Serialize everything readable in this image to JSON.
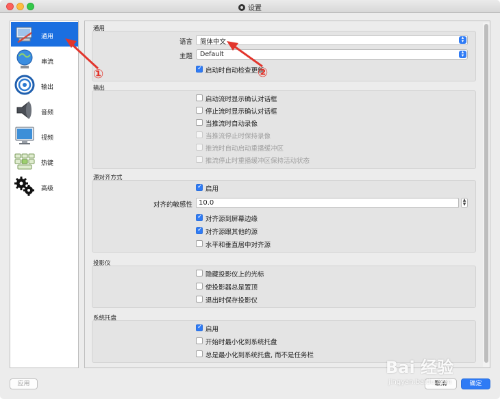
{
  "window": {
    "title": "设置"
  },
  "sidebar": {
    "items": [
      {
        "label": "通用",
        "icon": "general-icon",
        "active": true
      },
      {
        "label": "串流",
        "icon": "stream-icon"
      },
      {
        "label": "输出",
        "icon": "output-icon"
      },
      {
        "label": "音频",
        "icon": "audio-icon"
      },
      {
        "label": "视频",
        "icon": "video-icon"
      },
      {
        "label": "热键",
        "icon": "hotkeys-icon"
      },
      {
        "label": "高级",
        "icon": "advanced-icon"
      }
    ]
  },
  "general": {
    "section_title": "通用",
    "language_label": "语言",
    "language_value": "简体中文",
    "theme_label": "主题",
    "theme_value": "Default",
    "check_updates": {
      "label": "启动时自动检查更新",
      "checked": true
    }
  },
  "output": {
    "section_title": "输出",
    "options": [
      {
        "label": "启动流时显示确认对话框",
        "checked": false,
        "disabled": false
      },
      {
        "label": "停止流时显示确认对话框",
        "checked": false,
        "disabled": false
      },
      {
        "label": "当推流时自动录像",
        "checked": false,
        "disabled": false
      },
      {
        "label": "当推流停止时保持录像",
        "checked": false,
        "disabled": true
      },
      {
        "label": "推流时自动启动重播缓冲区",
        "checked": false,
        "disabled": true
      },
      {
        "label": "推流停止时重播缓冲区保持活动状态",
        "checked": false,
        "disabled": true
      }
    ]
  },
  "snapping": {
    "section_title": "源对齐方式",
    "enable": {
      "label": "启用",
      "checked": true
    },
    "sensitivity_label": "对齐的敏感性",
    "sensitivity_value": "10.0",
    "options": [
      {
        "label": "对齐源到屏幕边缘",
        "checked": true
      },
      {
        "label": "对齐源跟其他的源",
        "checked": true
      },
      {
        "label": "水平和垂直居中对齐源",
        "checked": false
      }
    ]
  },
  "projectors": {
    "section_title": "投影仪",
    "options": [
      {
        "label": "隐藏投影仪上的光标",
        "checked": false
      },
      {
        "label": "使投影器总是置顶",
        "checked": false
      },
      {
        "label": "退出时保存投影仪",
        "checked": false
      }
    ]
  },
  "tray": {
    "section_title": "系统托盘",
    "options": [
      {
        "label": "启用",
        "checked": true
      },
      {
        "label": "开始时最小化到系统托盘",
        "checked": false
      },
      {
        "label": "总是最小化到系统托盘, 而不是任务栏",
        "checked": false
      }
    ]
  },
  "buttons": {
    "apply": "应用",
    "cancel": "取消",
    "ok": "确定"
  },
  "annotations": {
    "marker1": "①",
    "marker2": "②"
  },
  "watermark": {
    "brand": "Bai 经验",
    "url": "jingyan.baidu.com"
  },
  "colors": {
    "accent": "#2f7bf5",
    "selection": "#1b6fe0",
    "annotation": "#e2352c"
  }
}
